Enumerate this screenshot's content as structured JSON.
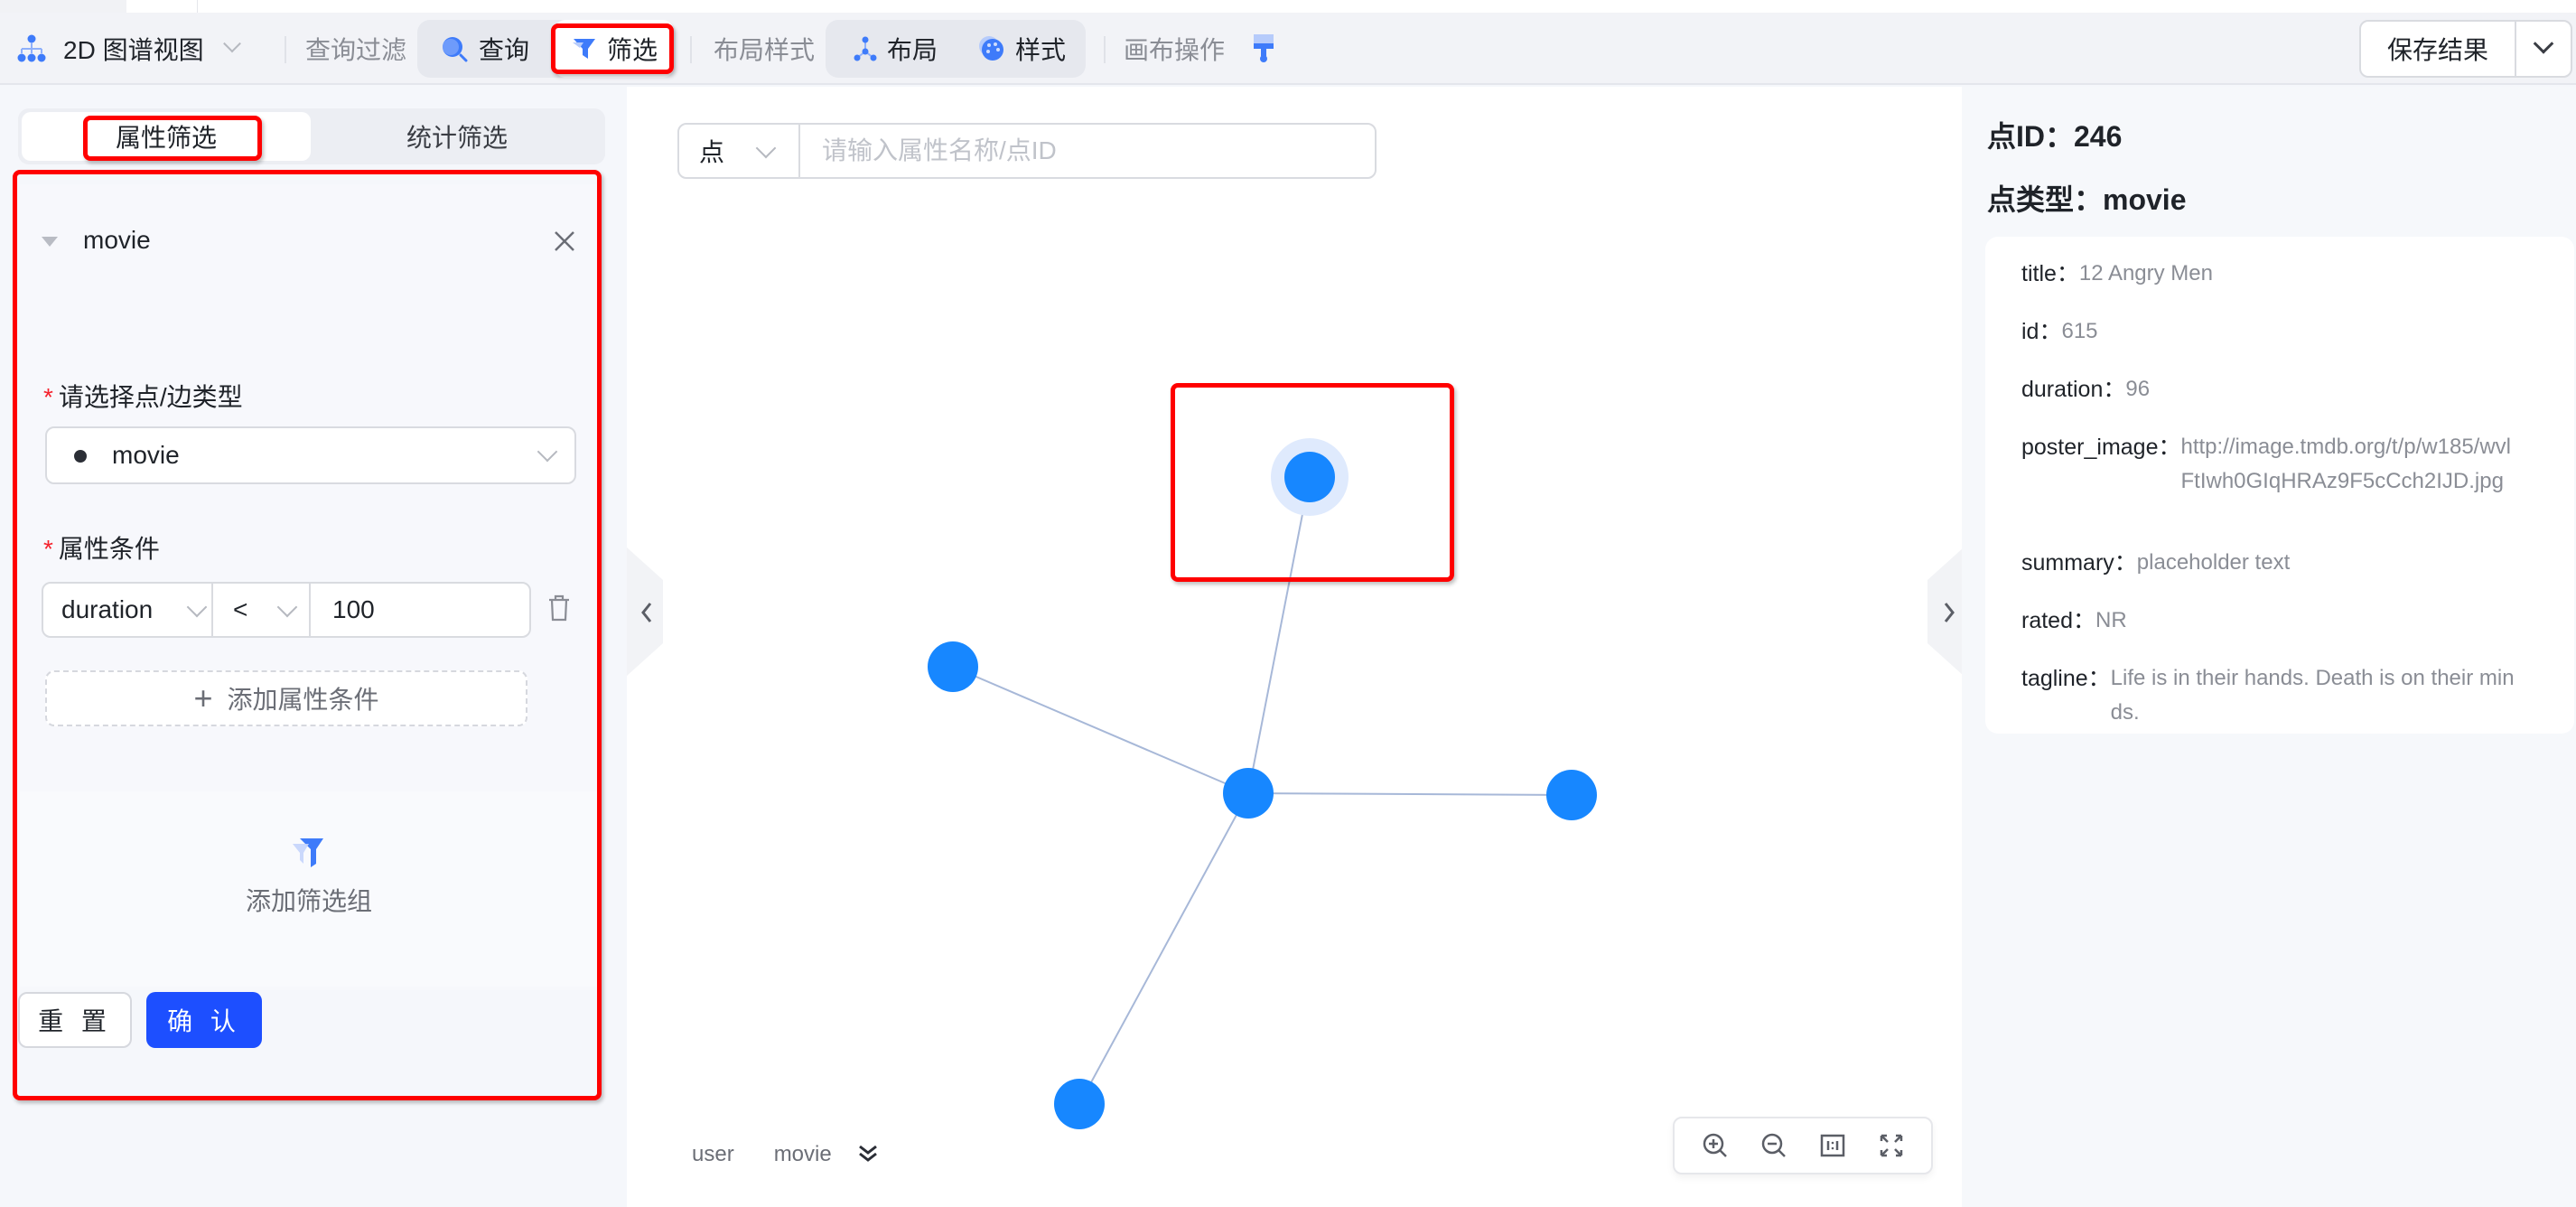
{
  "toolbar": {
    "view_selector": "2D 图谱视图",
    "section_query_filter": "查询过滤",
    "query_label": "查询",
    "filter_label": "筛选",
    "section_layout_style": "布局样式",
    "layout_label": "布局",
    "style_label": "样式",
    "section_canvas_ops": "画布操作",
    "save_label": "保存结果",
    "accent_color": "#3e7bfa"
  },
  "left_panel": {
    "tabs": [
      {
        "label": "属性筛选",
        "active": true
      },
      {
        "label": "统计筛选",
        "active": false
      }
    ],
    "filter_group": {
      "title": "movie",
      "type_label": "请选择点/边类型",
      "type_value": "movie",
      "condition_label": "属性条件",
      "condition": {
        "property": "duration",
        "operator": "<",
        "value": "100"
      },
      "add_condition_label": "添加属性条件"
    },
    "add_group_label": "添加筛选组",
    "reset_label": "重 置",
    "confirm_label": "确 认"
  },
  "canvas": {
    "search": {
      "type_value": "点",
      "placeholder": "请输入属性名称/点ID"
    },
    "legend": [
      "user",
      "movie"
    ],
    "node_color": "#1787ff",
    "edge_color": "#a7b8d8",
    "selected_halo_color": "#dfeafd",
    "nodes": [
      {
        "id": "n-top",
        "selected": true
      },
      {
        "id": "n-left",
        "selected": false
      },
      {
        "id": "n-center",
        "selected": false
      },
      {
        "id": "n-right",
        "selected": false
      },
      {
        "id": "n-bottom",
        "selected": false
      }
    ],
    "edges": [
      {
        "source": "n-center",
        "target": "n-top"
      },
      {
        "source": "n-center",
        "target": "n-left"
      },
      {
        "source": "n-center",
        "target": "n-right"
      },
      {
        "source": "n-center",
        "target": "n-bottom"
      }
    ]
  },
  "right_panel": {
    "node_id_label": "点ID：246",
    "node_type_label": "点类型：movie",
    "properties": [
      {
        "key": "title：",
        "value": "12 Angry Men"
      },
      {
        "key": "id：",
        "value": "615"
      },
      {
        "key": "duration：",
        "value": "96"
      },
      {
        "key": "poster_image：",
        "value": "http://image.tmdb.org/t/p/w185/wvlFtIwh0GIqHRAz9F5cCch2IJD.jpg"
      },
      {
        "key": "summary：",
        "value": "placeholder text"
      },
      {
        "key": "rated：",
        "value": "NR"
      },
      {
        "key": "tagline：",
        "value": "Life is in their hands. Death is on their minds."
      }
    ]
  }
}
